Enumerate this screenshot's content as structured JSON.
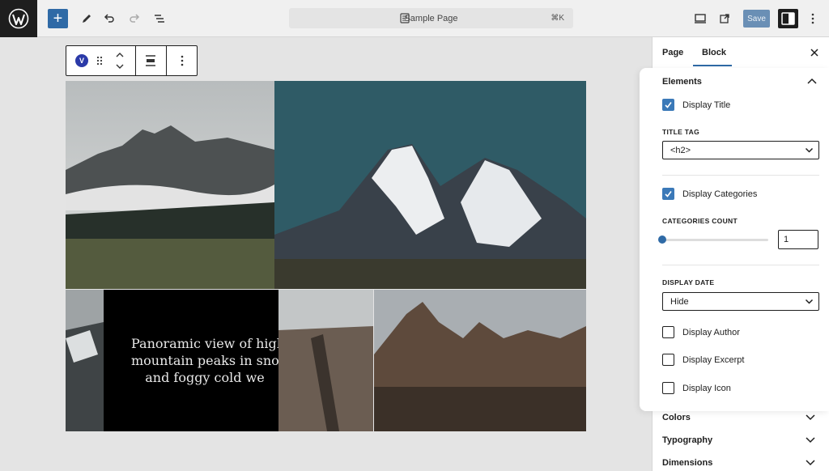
{
  "topbar": {
    "add_label": "+",
    "document_title": "Sample Page",
    "shortcut": "⌘K",
    "save_label": "Save"
  },
  "block_toolbar": {
    "badge": "V"
  },
  "caption": {
    "lines": [
      "Panoramic view of high",
      "mountain peaks in snow",
      "and foggy cold we"
    ]
  },
  "sidebar": {
    "tabs": [
      "Page",
      "Block"
    ],
    "active_tab": "Block",
    "elements_panel": {
      "title": "Elements",
      "display_title": {
        "label": "Display Title",
        "checked": true
      },
      "title_tag": {
        "label": "TITLE TAG",
        "value": "<h2>"
      },
      "display_categories": {
        "label": "Display Categories",
        "checked": true
      },
      "categories_count": {
        "label": "CATEGORIES COUNT",
        "value": "1"
      },
      "display_date": {
        "label": "DISPLAY DATE",
        "value": "Hide"
      },
      "display_author": {
        "label": "Display Author",
        "checked": false
      },
      "display_excerpt": {
        "label": "Display Excerpt",
        "checked": false
      },
      "display_icon": {
        "label": "Display Icon",
        "checked": false
      }
    },
    "collapsed_panels": [
      "Colors",
      "Typography",
      "Dimensions"
    ]
  },
  "colors": {
    "accent": "#2f6aa6",
    "checkbox_on": "#3b79b8",
    "brand_badge": "#2b3aa8"
  }
}
